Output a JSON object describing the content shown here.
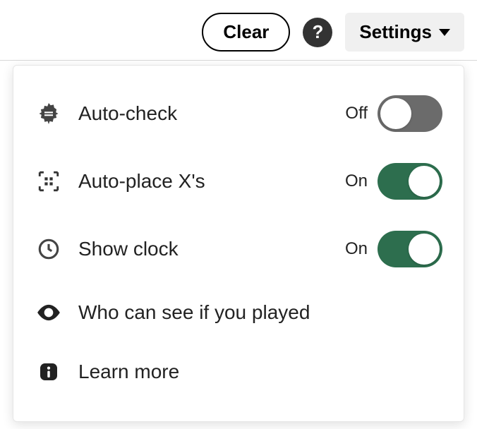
{
  "toolbar": {
    "clear_label": "Clear",
    "settings_label": "Settings"
  },
  "menu": {
    "items": [
      {
        "label": "Auto-check",
        "state_label": "Off",
        "on": false
      },
      {
        "label": "Auto-place X's",
        "state_label": "On",
        "on": true
      },
      {
        "label": "Show clock",
        "state_label": "On",
        "on": true
      },
      {
        "label": "Who can see if you played"
      },
      {
        "label": "Learn more"
      }
    ]
  },
  "labels": {
    "on": "On",
    "off": "Off"
  }
}
